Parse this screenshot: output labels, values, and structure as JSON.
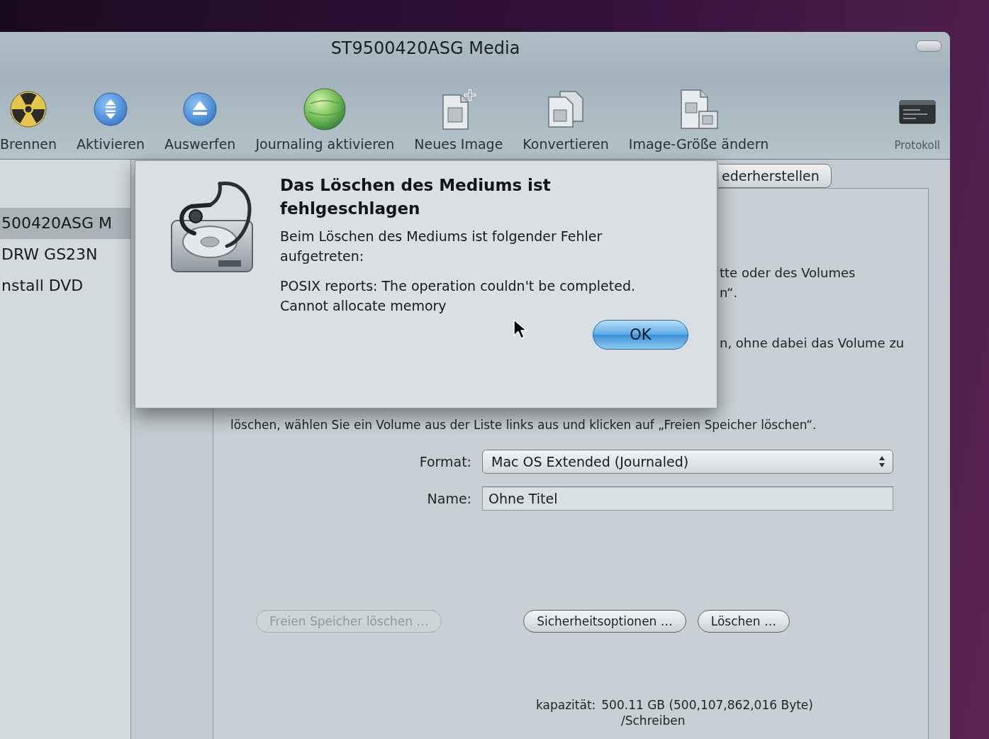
{
  "window": {
    "title": "ST9500420ASG Media"
  },
  "toolbar": {
    "items": [
      {
        "label": "Brennen"
      },
      {
        "label": "Aktivieren"
      },
      {
        "label": "Auswerfen"
      },
      {
        "label": "Journaling aktivieren"
      },
      {
        "label": "Neues Image"
      },
      {
        "label": "Konvertieren"
      },
      {
        "label": "Image-Größe ändern"
      },
      {
        "label": "Protokoll"
      }
    ]
  },
  "sidebar": {
    "items": [
      {
        "label": "500420ASG M",
        "selected": true
      },
      {
        "label": "DRW GS23N",
        "selected": false
      },
      {
        "label": "nstall DVD",
        "selected": false
      }
    ]
  },
  "tabs": [
    {
      "label": "ederherstellen",
      "selected": false
    }
  ],
  "panel": {
    "text_fragments": [
      "tte oder des Volumes",
      "n“.",
      "n, ohne dabei das Volume zu"
    ],
    "instruction": "löschen, wählen Sie ein Volume aus der Liste links aus und klicken auf „Freien Speicher löschen“.",
    "format": {
      "label": "Format:",
      "value": "Mac OS Extended (Journaled)"
    },
    "name": {
      "label": "Name:",
      "value": "Ohne Titel"
    },
    "buttons": [
      {
        "label": "Freien Speicher löschen …",
        "disabled": true
      },
      {
        "label": "Sicherheitsoptionen …",
        "disabled": false
      },
      {
        "label": "Löschen …",
        "disabled": false
      }
    ],
    "capacity": {
      "label": "kapazität:",
      "value": "500.11 GB (500,107,862,016 Byte)"
    },
    "detail_line": "/Schreiben"
  },
  "dialog": {
    "title": "Das Löschen des Mediums ist fehlgeschlagen",
    "message": "Beim Löschen des Mediums ist folgender Fehler aufgetreten:",
    "detail_lines": [
      "POSIX reports: The operation couldn't be completed.",
      "Cannot allocate memory"
    ],
    "button": "OK"
  }
}
